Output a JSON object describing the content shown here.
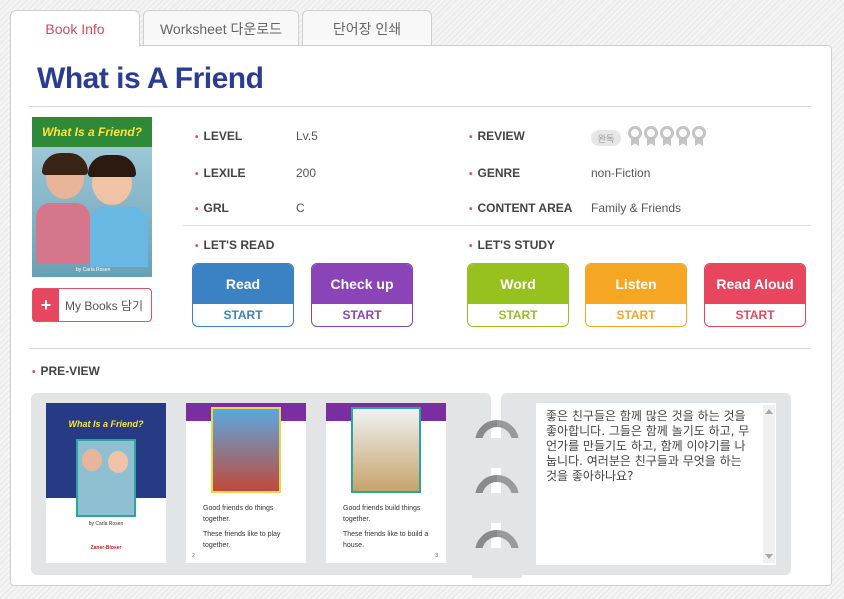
{
  "tabs": [
    {
      "label": "Book Info",
      "active": true
    },
    {
      "label": "Worksheet 다운로드",
      "active": false
    },
    {
      "label": "단어장 인쇄",
      "active": false
    }
  ],
  "book": {
    "title": "What is A Friend",
    "cover_title": "What Is a Friend?",
    "cover_byline": "by Carla Rosen",
    "my_books_label": "My Books 담기"
  },
  "info": {
    "level_label": "LEVEL",
    "level_value": "Lv.5",
    "lexile_label": "LEXILE",
    "lexile_value": "200",
    "grl_label": "GRL",
    "grl_value": "C",
    "review_label": "REVIEW",
    "review_badge": "완독",
    "review_medals": 5,
    "genre_label": "GENRE",
    "genre_value": "non-Fiction",
    "content_area_label": "CONTENT AREA",
    "content_area_value": "Family & Friends"
  },
  "lets_read": {
    "label": "LET'S READ",
    "buttons": [
      {
        "name": "Read",
        "action": "START",
        "color": "#3b82c4"
      },
      {
        "name": "Check up",
        "action": "START",
        "color": "#8b44b8"
      }
    ]
  },
  "lets_study": {
    "label": "LET'S STUDY",
    "buttons": [
      {
        "name": "Word",
        "action": "START",
        "color": "#96c11f"
      },
      {
        "name": "Listen",
        "action": "START",
        "color": "#f5a623"
      },
      {
        "name": "Read Aloud",
        "action": "START",
        "color": "#e8455f"
      }
    ]
  },
  "preview": {
    "label": "PRE-VIEW",
    "pages": [
      {
        "title": "What Is a Friend?",
        "byline": "by Carla Rosen",
        "publisher": "Zaner-Bloser"
      },
      {
        "line1": "Good friends do things together.",
        "line2": "These friends like to play together.",
        "page_no": "2"
      },
      {
        "line1": "Good friends build things together.",
        "line2": "These friends like to build a house.",
        "page_no": "3"
      }
    ],
    "text": "좋은 친구들은 함께 많은 것을 하는 것을 좋아합니다. 그들은 함께 놀기도 하고, 무언가를 만들기도 하고, 함께 이야기를 나눕니다. 여러분은 친구들과 무엇을 하는 것을 좋아하나요?"
  }
}
